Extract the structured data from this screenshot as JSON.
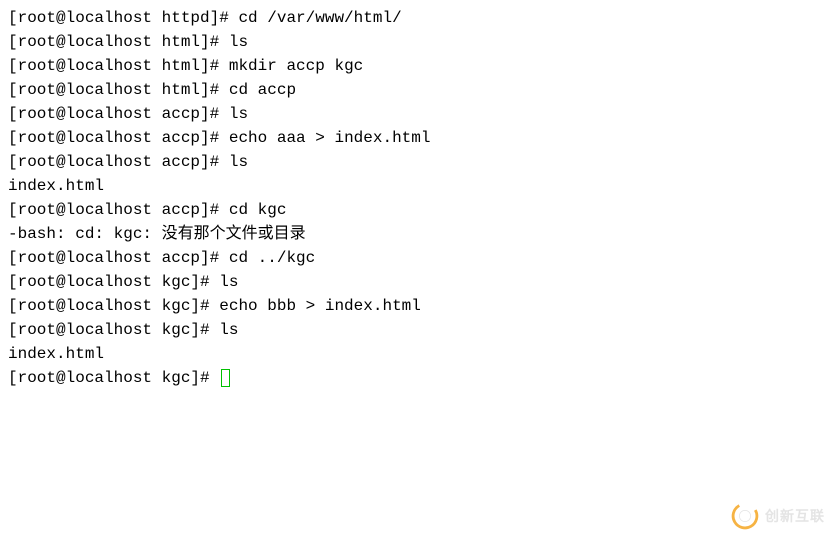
{
  "lines": [
    {
      "prompt": "[root@localhost httpd]# ",
      "cmd": "cd /var/www/html/"
    },
    {
      "prompt": "[root@localhost html]# ",
      "cmd": "ls"
    },
    {
      "prompt": "[root@localhost html]# ",
      "cmd": "mkdir accp kgc"
    },
    {
      "prompt": "[root@localhost html]# ",
      "cmd": "cd accp"
    },
    {
      "prompt": "[root@localhost accp]# ",
      "cmd": "ls"
    },
    {
      "prompt": "[root@localhost accp]# ",
      "cmd": "echo aaa > index.html"
    },
    {
      "prompt": "[root@localhost accp]# ",
      "cmd": "ls"
    },
    {
      "output": "index.html"
    },
    {
      "prompt": "[root@localhost accp]# ",
      "cmd": "cd kgc"
    },
    {
      "output": "-bash: cd: kgc: 没有那个文件或目录"
    },
    {
      "prompt": "[root@localhost accp]# ",
      "cmd": "cd ../kgc"
    },
    {
      "prompt": "[root@localhost kgc]# ",
      "cmd": "ls"
    },
    {
      "prompt": "[root@localhost kgc]# ",
      "cmd": "echo bbb > index.html"
    },
    {
      "prompt": "[root@localhost kgc]# ",
      "cmd": "ls"
    },
    {
      "output": "index.html"
    },
    {
      "prompt": "[root@localhost kgc]# ",
      "cmd": "",
      "cursor": true
    }
  ],
  "watermark": {
    "text": "创新互联",
    "icon_color_outer": "#f5a623",
    "icon_color_inner": "#ffffff"
  }
}
